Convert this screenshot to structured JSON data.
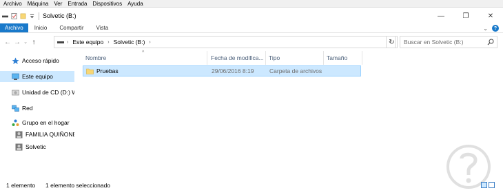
{
  "vbox_menu": [
    "Archivo",
    "Máquina",
    "Ver",
    "Entrada",
    "Dispositivos",
    "Ayuda"
  ],
  "window": {
    "title": "Solvetic (B:)",
    "minimize": "—",
    "maximize": "❐",
    "close": "✕"
  },
  "ribbon": {
    "tabs": [
      "Archivo",
      "Inicio",
      "Compartir",
      "Vista"
    ],
    "expand_glyph": "⌄",
    "help_glyph": "?"
  },
  "address": {
    "back": "←",
    "forward": "→",
    "recent": "⌄",
    "up": "↑",
    "crumbs": [
      "Este equipo",
      "Solvetic (B:)"
    ],
    "separator": "›",
    "dropdown": "⌄",
    "refresh": "↻",
    "search_placeholder": "Buscar en Solvetic (B:)"
  },
  "navigation": {
    "items": [
      {
        "label": "Acceso rápido",
        "icon": "star-icon"
      },
      {
        "label": "Este equipo",
        "icon": "computer-icon",
        "selected": true
      },
      {
        "label": "Unidad de CD (D:) WI",
        "icon": "cd-drive-icon"
      },
      {
        "label": "Red",
        "icon": "network-icon"
      },
      {
        "label": "Grupo en el hogar",
        "icon": "homegroup-icon"
      },
      {
        "label": "FAMILIA QUIÑONES",
        "icon": "user-icon"
      },
      {
        "label": "Solvetic",
        "icon": "user-icon"
      }
    ]
  },
  "columns": {
    "name": "Nombre",
    "date": "Fecha de modifica...",
    "type": "Tipo",
    "size": "Tamaño"
  },
  "files": [
    {
      "name": "Pruebas",
      "date": "29/06/2016 8:19",
      "type": "Carpeta de archivos",
      "size": "",
      "icon": "folder-icon"
    }
  ],
  "status": {
    "count": "1 elemento",
    "selected": "1 elemento seleccionado"
  },
  "colors": {
    "accent": "#1979ca",
    "selection": "#cce8ff",
    "selection_border": "#99d1ff",
    "folder": "#f8d775",
    "header_text": "#4c607a"
  }
}
